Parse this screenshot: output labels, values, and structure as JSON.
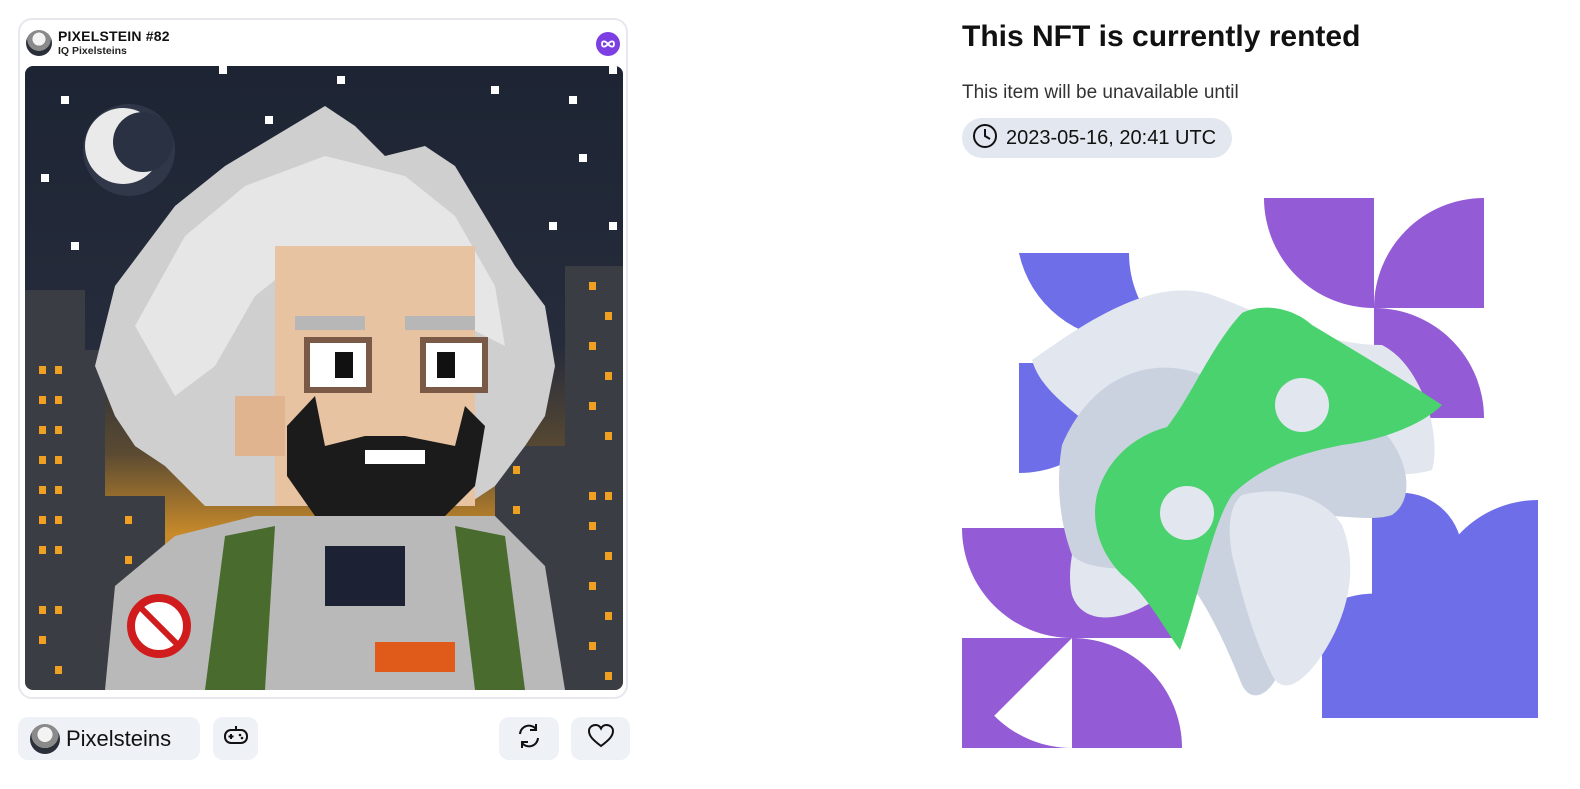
{
  "card": {
    "title": "PIXELSTEIN #82",
    "collection": "IQ Pixelsteins",
    "chain_icon": "polygon-icon"
  },
  "actions": {
    "collection_label": "Pixelsteins",
    "game_icon": "gamepad-icon",
    "refresh_icon": "refresh-icon",
    "like_icon": "heart-icon"
  },
  "rental": {
    "headline": "This NFT is currently rented",
    "subtext": "This item will be unavailable until",
    "until": "2023-05-16, 20:41 UTC",
    "clock_icon": "clock-icon"
  },
  "colors": {
    "purple": "#945bd6",
    "indigo": "#6e6fe8",
    "green": "#4ad26e",
    "gray_light": "#e1e6ef",
    "gray_mid": "#cad2df",
    "pill_bg": "#e3e7ef",
    "button_bg": "#eef1f6"
  }
}
